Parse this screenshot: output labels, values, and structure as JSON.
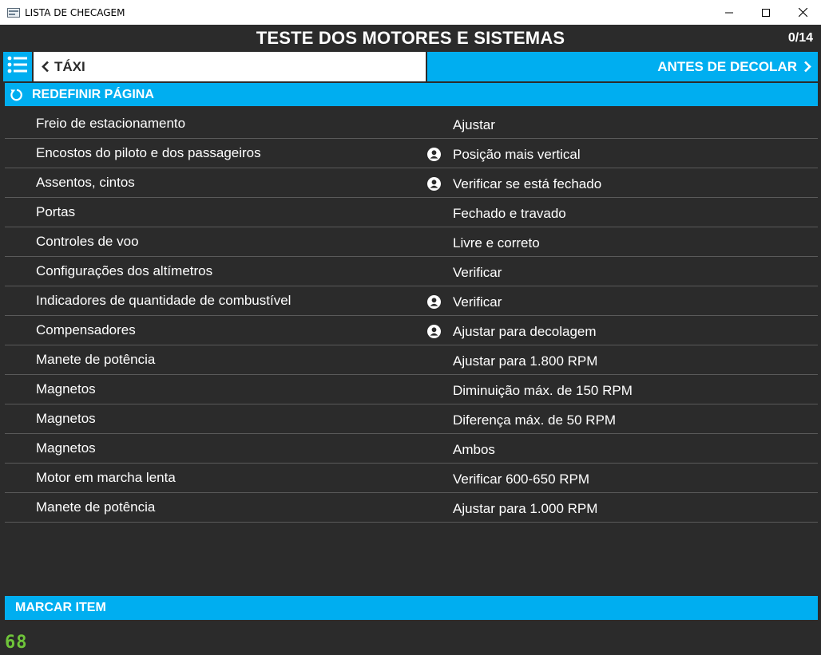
{
  "window": {
    "title": "LISTA DE CHECAGEM",
    "controls": [
      "minimize-icon",
      "maximize-icon",
      "close-icon"
    ]
  },
  "header": {
    "title": "TESTE DOS MOTORES E SISTEMAS",
    "counter": "0/14"
  },
  "nav": {
    "prev_label": "TÁXI",
    "next_label": "ANTES DE DECOLAR"
  },
  "reset_label": "REDEFINIR PÁGINA",
  "items": [
    {
      "item": "Freio de estacionamento",
      "action": "Ajustar",
      "person": false
    },
    {
      "item": "Encostos do piloto e dos passageiros",
      "action": "Posição mais vertical",
      "person": true
    },
    {
      "item": "Assentos, cintos",
      "action": "Verificar se está fechado",
      "person": true
    },
    {
      "item": "Portas",
      "action": "Fechado e travado",
      "person": false
    },
    {
      "item": "Controles de voo",
      "action": "Livre e correto",
      "person": false
    },
    {
      "item": "Configurações dos altímetros",
      "action": "Verificar",
      "person": false
    },
    {
      "item": "Indicadores de quantidade de combustível",
      "action": "Verificar",
      "person": true
    },
    {
      "item": "Compensadores",
      "action": "Ajustar para decolagem",
      "person": true
    },
    {
      "item": "Manete de potência",
      "action": "Ajustar para 1.800 RPM",
      "person": false
    },
    {
      "item": "Magnetos",
      "action": "Diminuição máx. de 150 RPM",
      "person": false
    },
    {
      "item": "Magnetos",
      "action": "Diferença máx. de 50 RPM",
      "person": false
    },
    {
      "item": "Magnetos",
      "action": "Ambos",
      "person": false
    },
    {
      "item": "Motor em marcha lenta",
      "action": "Verificar 600-650 RPM",
      "person": false
    },
    {
      "item": "Manete de potência",
      "action": "Ajustar para 1.000 RPM",
      "person": false
    }
  ],
  "mark_label": "MARCAR ITEM",
  "fps_counter": "68",
  "colors": {
    "accent": "#00aef0",
    "background": "#2b2b2b",
    "fps": "#6fc53a"
  }
}
